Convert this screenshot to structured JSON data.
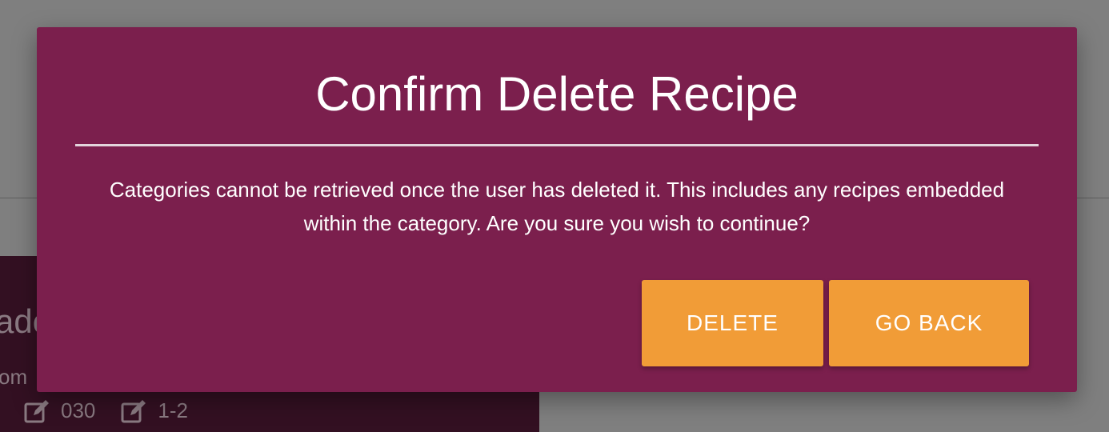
{
  "background": {
    "card": {
      "title_fragment": "ado",
      "subtitle_fragment": "om",
      "meta": [
        {
          "icon": "edit-icon",
          "value": "030"
        },
        {
          "icon": "edit-icon",
          "value": "1-2"
        }
      ]
    }
  },
  "modal": {
    "title": "Confirm Delete Recipe",
    "message": "Categories cannot be retrieved once the user has deleted it. This includes any recipes embedded within the category. Are you sure you wish to continue?",
    "delete_label": "DELETE",
    "back_label": "GO BACK"
  },
  "colors": {
    "modal_bg": "#7b1f4d",
    "button_bg": "#f19c37",
    "overlay": "#7f7f7f"
  }
}
